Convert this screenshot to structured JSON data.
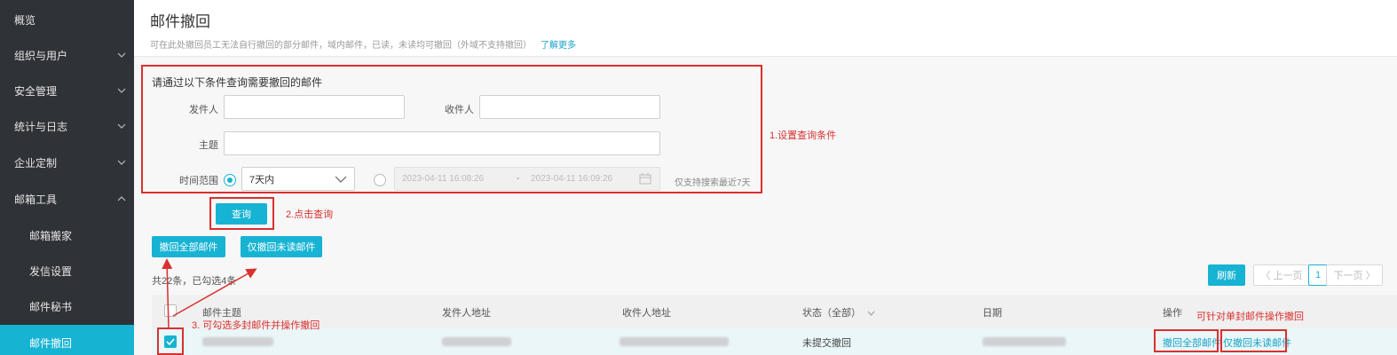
{
  "sidebar": {
    "items": [
      {
        "label": "概览"
      },
      {
        "label": "组织与用户"
      },
      {
        "label": "安全管理"
      },
      {
        "label": "统计与日志"
      },
      {
        "label": "企业定制"
      },
      {
        "label": "邮箱工具"
      },
      {
        "label": "邮箱搬家"
      },
      {
        "label": "发信设置"
      },
      {
        "label": "邮件秘书"
      },
      {
        "label": "邮件撤回"
      }
    ]
  },
  "header": {
    "title": "邮件撤回",
    "description": "可在此处撤回员工无法自行撤回的部分邮件，域内邮件，已读，未读均可撤回（外域不支持撤回）",
    "learn_more": "了解更多"
  },
  "form": {
    "title": "请通过以下条件查询需要撤回的邮件",
    "sender_label": "发件人",
    "sender_value": "",
    "recipient_label": "收件人",
    "recipient_value": "",
    "subject_label": "主题",
    "subject_value": "",
    "time_label": "时间范围",
    "time_preset": "7天内",
    "date_start": "2023-04-11 16:08:26",
    "date_sep": "-",
    "date_end": "2023-04-11 16:09:26",
    "time_hint": "仅支持搜索最近7天"
  },
  "actions": {
    "query": "查询",
    "recall_all": "撤回全部邮件",
    "recall_unread": "仅撤回未读邮件",
    "refresh": "刷新",
    "prev_page": "〈 上一页",
    "page": "1",
    "next_page": "下一页 〉",
    "summary": "共22条，已勾选4条"
  },
  "table": {
    "columns": [
      "邮件主题",
      "发件人地址",
      "收件人地址",
      "状态（全部）",
      "日期",
      "操作"
    ],
    "row": {
      "status": "未提交撤回",
      "op_recall_all": "撤回全部邮件",
      "op_recall_unread": "仅撤回未读邮件"
    }
  },
  "annotations": {
    "step1": "1.设置查询条件",
    "step2": "2.点击查询",
    "step3": "3. 可勾选多封邮件并操作撤回",
    "single": "可针对单封邮件操作撤回"
  },
  "colors": {
    "accent": "#17b3d3",
    "sidebar_bg": "#2f3237",
    "annotation_red": "#d9302f"
  }
}
